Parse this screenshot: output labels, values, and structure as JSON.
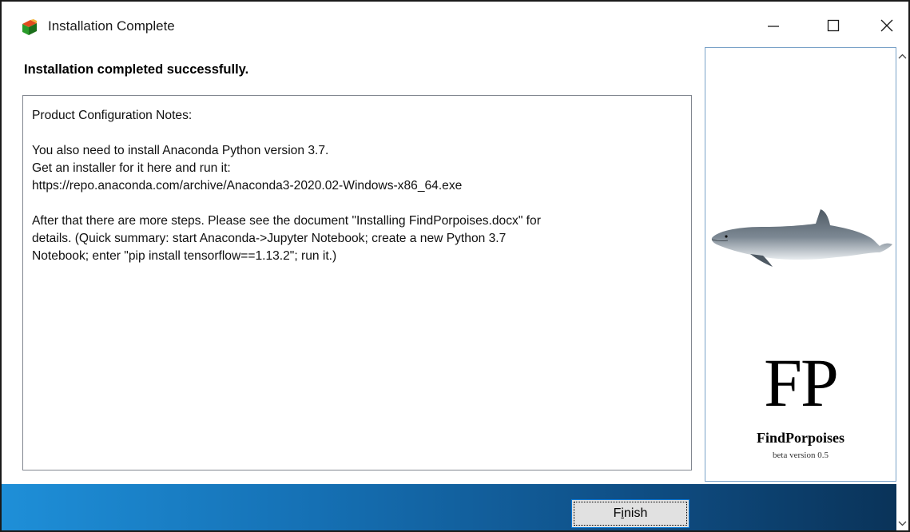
{
  "window": {
    "title": "Installation Complete"
  },
  "titlebar": {
    "minimize_icon": "minimize-icon",
    "maximize_icon": "maximize-icon",
    "close_icon": "close-icon"
  },
  "content": {
    "heading": "Installation completed successfully.",
    "notes": [
      "Product Configuration Notes:",
      "",
      "You also need to install Anaconda Python version 3.7.",
      "Get an installer for it here and run it:",
      "https://repo.anaconda.com/archive/Anaconda3-2020.02-Windows-x86_64.exe",
      "",
      "After that there are more steps. Please see the document \"Installing FindPorpoises.docx\" for",
      "details. (Quick summary: start Anaconda->Jupyter Notebook; create a new Python 3.7",
      "Notebook; enter \"pip install tensorflow==1.13.2\"; run it.)"
    ]
  },
  "side_panel": {
    "logo": "FP",
    "product_name": "FindPorpoises",
    "version": "beta version 0.5"
  },
  "footer": {
    "finish_pre": "F",
    "finish_mnemonic": "i",
    "finish_post": "nish"
  },
  "colors": {
    "accent": "#0078d7",
    "bottombar_start": "#1e8fd8",
    "bottombar_end": "#0a3359"
  }
}
